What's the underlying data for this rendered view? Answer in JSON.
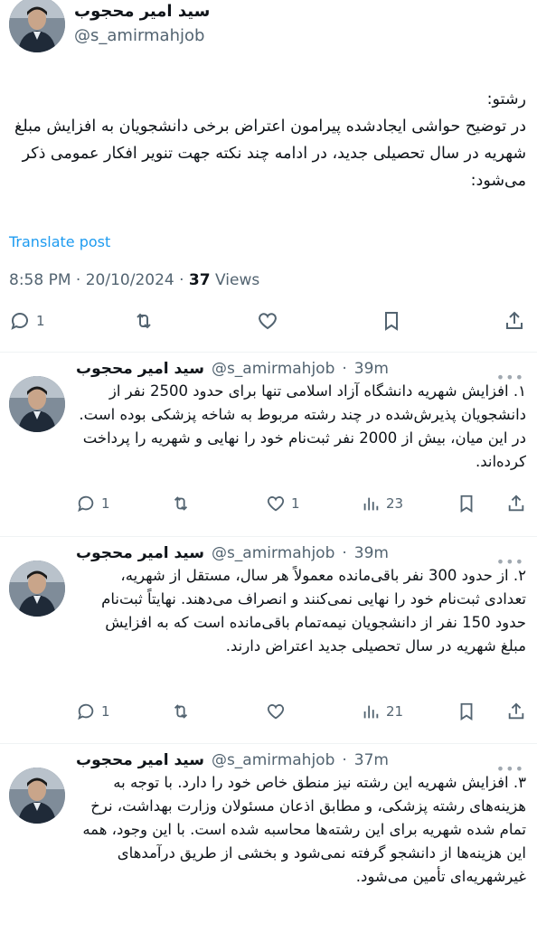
{
  "main_post": {
    "display_name": "سید امیر محجوب",
    "handle": "@s_amirmahjob",
    "text": "رشتو:\nدر توضیح حواشی ایجادشده پیرامون اعتراض برخی دانشجویان به افزایش مبلغ شهریه در سال تحصیلی جدید، در ادامه چند نکته جهت تنویر افکار عمومی ذکر می‌شود:",
    "translate_label": "Translate post",
    "time": "8:58 PM",
    "date": "20/10/2024",
    "separator": "·",
    "views_count": "37",
    "views_label": "Views",
    "replies_count": "1"
  },
  "replies": [
    {
      "display_name": "سید امیر محجوب",
      "handle": "@s_amirmahjob",
      "time": "39m",
      "text": "۱. افزایش شهریه دانشگاه آزاد اسلامی تنها برای حدود 2500 نفر از دانشجویان پذیرش‌شده در چند رشته مربوط به شاخه پزشکی بوده است. در این میان، بیش از 2000 نفر ثبت‌نام خود را نهایی و شهریه را پرداخت کرده‌اند.",
      "replies": "1",
      "likes": "1",
      "views": "23"
    },
    {
      "display_name": "سید امیر محجوب",
      "handle": "@s_amirmahjob",
      "time": "39m",
      "text": "۲. از حدود 300 نفر باقی‌مانده معمولاً هر سال، مستقل از شهریه، تعدادی ثبت‌نام خود را نهایی نمی‌کنند و انصراف می‌دهند. نهایتاً ثبت‌نام حدود 150 نفر از دانشجویان نیمه‌تمام باقی‌مانده است که به افزایش مبلغ شهریه در سال تحصیلی جدید اعتراض دارند.",
      "replies": "1",
      "likes": "",
      "views": "21"
    },
    {
      "display_name": "سید امیر محجوب",
      "handle": "@s_amirmahjob",
      "time": "37m",
      "text": "۳. افزایش شهریه این رشته نیز منطق خاص خود را دارد. با توجه به هزینه‌های رشته پزشکی، و مطابق اذعان مسئولان وزارت بهداشت، نرخ تمام شده شهریه برای این رشته‌ها محاسبه شده است. با این وجود، همه این هزینه‌ها از دانشجو گرفته نمی‌شود و بخشی از طریق درآمدهای غیرشهریه‌ای تأمین می‌شود.",
      "replies": "",
      "likes": "",
      "views": ""
    }
  ],
  "icons": {
    "reply": "speech-bubble-icon",
    "repost": "repost-arrows-icon",
    "like": "heart-icon",
    "views": "bar-chart-icon",
    "bookmark": "bookmark-icon",
    "share": "share-upload-icon",
    "more": "more-dots-icon"
  },
  "colors": {
    "link": "#1d9bf0",
    "secondary_text": "#536471",
    "divider": "#eff3f4"
  }
}
